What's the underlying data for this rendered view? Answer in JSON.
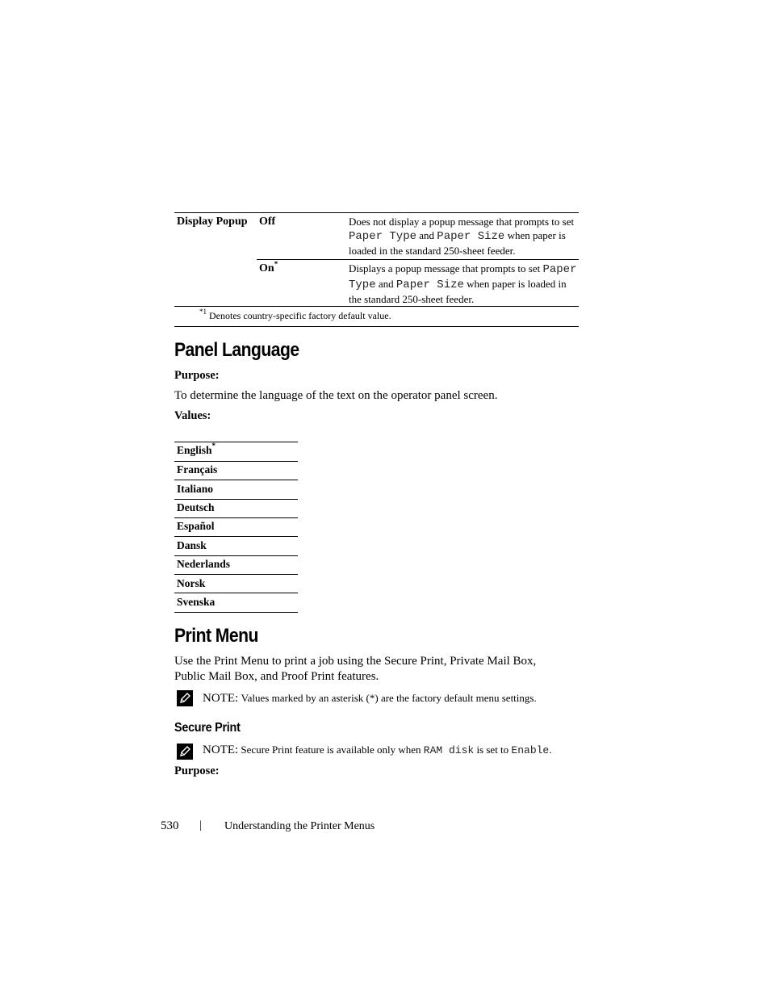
{
  "display_popup_table": {
    "setting_label": "Display Popup",
    "rows": [
      {
        "value": "Off",
        "is_default": false,
        "description_parts": [
          "Does not display a popup message that prompts to set ",
          "Paper Type",
          " and ",
          "Paper Size",
          " when paper is loaded in the standard 250-sheet feeder."
        ]
      },
      {
        "value": "On",
        "is_default": true,
        "default_marker": "*",
        "description_parts": [
          "Displays a popup message that prompts to set ",
          "Paper Type",
          " and ",
          "Paper Size",
          " when paper is loaded in the standard 250-sheet feeder."
        ]
      }
    ],
    "footnote_marker": "*1",
    "footnote_text": "Denotes country-specific factory default value."
  },
  "panel_language": {
    "heading": "Panel Language",
    "purpose_label": "Purpose:",
    "purpose_text": "To determine the language of the text on the operator panel screen.",
    "values_label": "Values:",
    "languages": [
      {
        "name": "English",
        "marker": "*"
      },
      {
        "name": "Français",
        "marker": ""
      },
      {
        "name": "Italiano",
        "marker": ""
      },
      {
        "name": "Deutsch",
        "marker": ""
      },
      {
        "name": "Español",
        "marker": ""
      },
      {
        "name": "Dansk",
        "marker": ""
      },
      {
        "name": "Nederlands",
        "marker": ""
      },
      {
        "name": "Norsk",
        "marker": ""
      },
      {
        "name": "Svenska",
        "marker": ""
      }
    ]
  },
  "print_menu": {
    "heading": "Print Menu",
    "intro_line1": "Use the Print Menu to print a job using the Secure Print, Private Mail Box,",
    "intro_line2": "Public Mail Box, and Proof Print features.",
    "note1": {
      "icon": "pencil-note-icon",
      "label": "NOTE:",
      "text": "Values marked by an asterisk (*) are the factory default menu settings."
    },
    "secure_print": {
      "heading": "Secure Print",
      "note": {
        "icon": "pencil-note-icon",
        "label": "NOTE:",
        "text_before": "Secure Print feature is available only when ",
        "code1": "RAM disk",
        "text_middle": " is set to ",
        "code2": "Enable",
        "text_after": "."
      },
      "purpose_label": "Purpose:"
    }
  },
  "footer": {
    "page_number": "530",
    "separator": "|",
    "chapter_title": "Understanding the Printer Menus"
  }
}
